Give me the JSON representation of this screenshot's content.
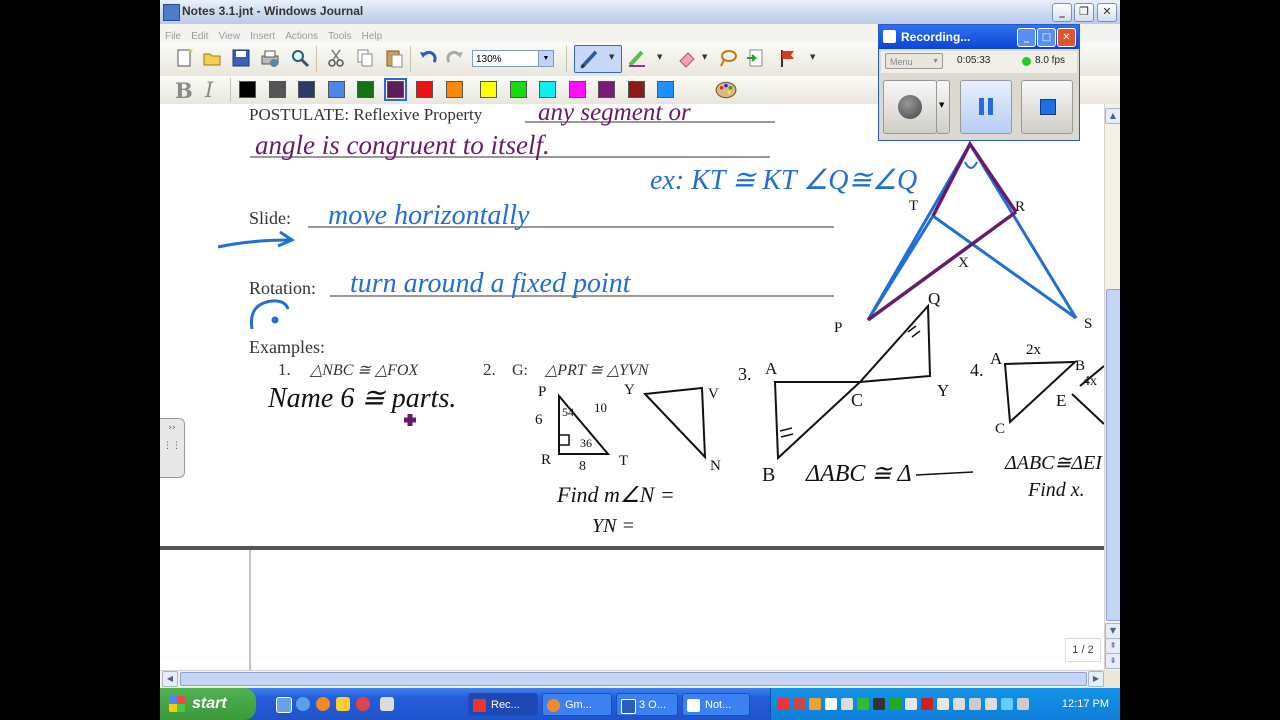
{
  "window": {
    "title": "Notes 3.1.jnt - Windows Journal"
  },
  "menu": [
    "File",
    "Edit",
    "View",
    "Insert",
    "Actions",
    "Tools",
    "Help"
  ],
  "toolbar": {
    "zoom": "130%",
    "bold_label": "B",
    "italic_label": "I"
  },
  "palette": [
    "#000000",
    "#555555",
    "#2e3a66",
    "#4c86ea",
    "#127412",
    "#5c1d5c",
    "#ee1111",
    "#ff8a00",
    "#ffff00",
    "#11dd11",
    "#11eeee",
    "#ff11ff",
    "#7b1a7b",
    "#8b1a1a",
    "#1e90ff"
  ],
  "palette_selected_index": 5,
  "recorder": {
    "title": "Recording...",
    "menu_label": "Menu",
    "time": "0:05:33",
    "fps": "8.0 fps"
  },
  "notes": {
    "postulate_label": "POSTULATE: Reflexive Property",
    "postulate_hw1": "any segment or",
    "postulate_hw2": "angle is congruent to itself.",
    "example_reflexive": "ex: KT ≅ KT   ∠Q≅∠Q",
    "slide_label": "Slide:",
    "slide_hw": "move horizontally",
    "rotation_label": "Rotation:",
    "rotation_hw": "turn around a fixed point",
    "examples_label": "Examples:",
    "ex1_num": "1.",
    "ex1_congruence": "△NBC ≅ △FOX",
    "ex1_hw": "Name 6 ≅ parts.",
    "ex2_num": "2.",
    "ex2_prefix": "G:",
    "ex2_congruence": "△PRT ≅ △YVN",
    "ex2_find_angle": "Find m∠N =",
    "ex2_find_side": "YN =",
    "ex3_num": "3.",
    "ex3_statement": "ΔABC ≅ Δ",
    "ex4_num": "4.",
    "ex4_statement": "ΔABC≅ΔEI",
    "ex4_find": "Find x."
  },
  "diagram_labels": {
    "T": "T",
    "R": "R",
    "X": "X",
    "P": "P",
    "S": "S",
    "Q": "Q"
  },
  "ex2_labels": {
    "P": "P",
    "R": "R",
    "T": "T",
    "Y": "Y",
    "V": "V",
    "N": "N",
    "side_pr": "6",
    "side_pt": "10",
    "side_rt": "8",
    "angle_p": "54",
    "angle_t": "36"
  },
  "ex3_labels": {
    "A": "A",
    "B": "B",
    "C": "C",
    "Y": "Y",
    "Q": "Q"
  },
  "ex4_labels": {
    "A": "A",
    "B": "B",
    "C": "C",
    "E": "E",
    "top": "2x",
    "right": "4x"
  },
  "status": {
    "page": "1 / 2"
  },
  "taskbar": {
    "start": "start",
    "tasks": [
      "Rec...",
      "Gm...",
      "3 O...",
      "Not..."
    ],
    "clock": "12:17 PM"
  }
}
